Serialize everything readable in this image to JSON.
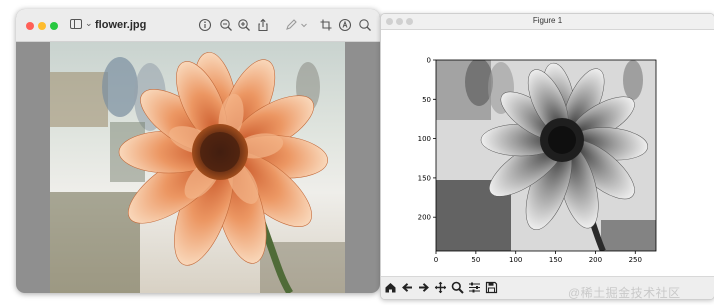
{
  "preview_window": {
    "title": "flower.jpg",
    "toolbar": {
      "icons": [
        "sidebar-icon",
        "info-icon",
        "zoom-out-icon",
        "zoom-in-icon",
        "share-icon",
        "pen-icon",
        "crop-icon",
        "markup-icon",
        "search-icon"
      ]
    }
  },
  "figure_window": {
    "title": "Figure 1",
    "chart_data": {
      "type": "image",
      "x_ticks": [
        "0",
        "50",
        "100",
        "150",
        "200",
        "250"
      ],
      "y_ticks": [
        "0",
        "50",
        "100",
        "150",
        "200"
      ],
      "xlim": [
        0,
        276
      ],
      "ylim": [
        243,
        0
      ],
      "grid": false
    },
    "toolbar_icons": [
      "home-icon",
      "back-icon",
      "forward-icon",
      "pan-icon",
      "zoom-icon",
      "configure-icon",
      "save-icon"
    ]
  },
  "watermark": "@稀土掘金技术社区",
  "colors": {
    "close": "#ff5f57",
    "minimize": "#febc2e",
    "zoom": "#28c840"
  }
}
